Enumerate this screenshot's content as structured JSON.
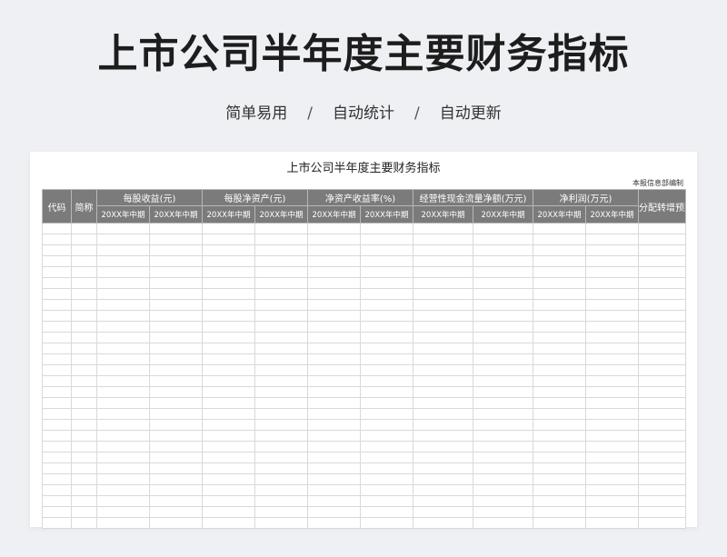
{
  "header": {
    "title": "上市公司半年度主要财务指标",
    "taglines": [
      "简单易用",
      "自动统计",
      "自动更新"
    ],
    "separator": "/"
  },
  "sheet": {
    "title": "上市公司半年度主要财务指标",
    "note": "本报信息部编制",
    "columns": {
      "code": "代码",
      "abbr": "简称",
      "groups": [
        {
          "label": "每股收益(元)",
          "subs": [
            "20XX年中期",
            "20XX年中期"
          ]
        },
        {
          "label": "每股净资产(元)",
          "subs": [
            "20XX年中期",
            "20XX年中期"
          ]
        },
        {
          "label": "净资产收益率(%)",
          "subs": [
            "20XX年中期",
            "20XX年中期"
          ]
        },
        {
          "label": "经营性现金流量净额(万元)",
          "subs": [
            "20XX年中期",
            "20XX年中期"
          ]
        },
        {
          "label": "净利润(万元)",
          "subs": [
            "20XX年中期",
            "20XX年中期"
          ]
        }
      ],
      "plan": "分配转增预案"
    },
    "empty_rows": 28
  }
}
